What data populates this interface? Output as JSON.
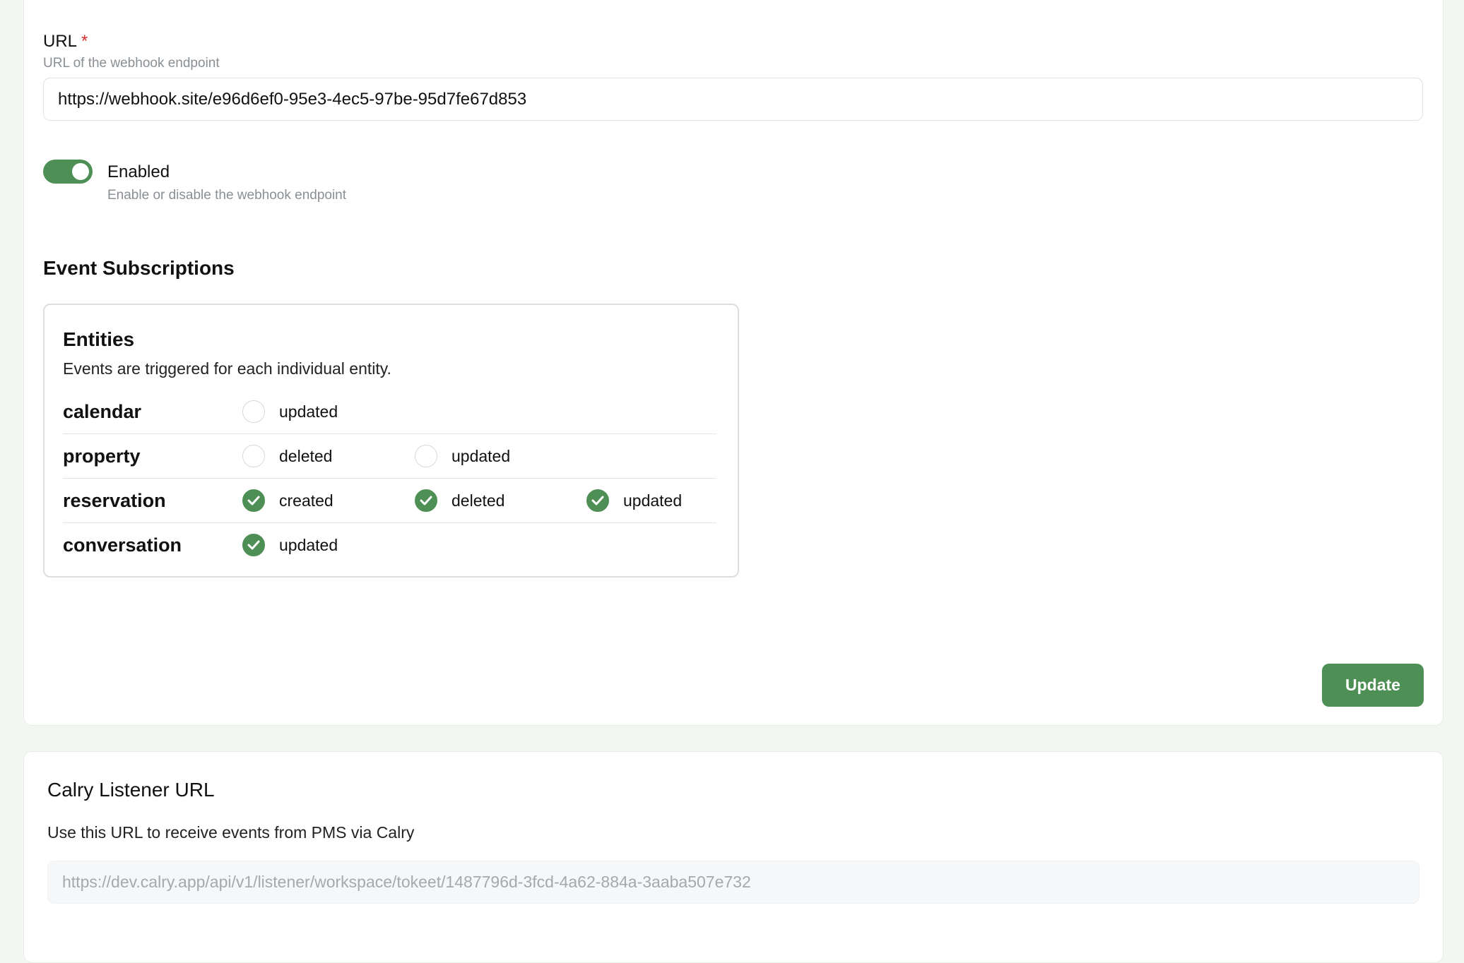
{
  "webhook_form": {
    "url_field": {
      "label": "URL",
      "required_marker": "*",
      "hint": "URL of the webhook endpoint",
      "value": "https://webhook.site/e96d6ef0-95e3-4ec5-97be-95d7fe67d853"
    },
    "enabled_toggle": {
      "label": "Enabled",
      "hint": "Enable or disable the webhook endpoint",
      "on": true
    },
    "event_subscriptions": {
      "title": "Event Subscriptions",
      "entities": {
        "title": "Entities",
        "description": "Events are triggered for each individual entity.",
        "rows": [
          {
            "name": "calendar",
            "options": [
              {
                "label": "updated",
                "checked": false
              }
            ]
          },
          {
            "name": "property",
            "options": [
              {
                "label": "deleted",
                "checked": false
              },
              {
                "label": "updated",
                "checked": false
              }
            ]
          },
          {
            "name": "reservation",
            "options": [
              {
                "label": "created",
                "checked": true
              },
              {
                "label": "deleted",
                "checked": true
              },
              {
                "label": "updated",
                "checked": true
              }
            ]
          },
          {
            "name": "conversation",
            "options": [
              {
                "label": "updated",
                "checked": true
              }
            ]
          }
        ]
      }
    },
    "update_button_label": "Update"
  },
  "listener": {
    "title": "Calry Listener URL",
    "description": "Use this URL to receive events from PMS via Calry",
    "url": "https://dev.calry.app/api/v1/listener/workspace/tokeet/1487796d-3fcd-4a62-884a-3aaba507e732"
  },
  "colors": {
    "accent": "#4e8f55",
    "required": "#d32f2f",
    "page_background": "#f2f7f2"
  }
}
